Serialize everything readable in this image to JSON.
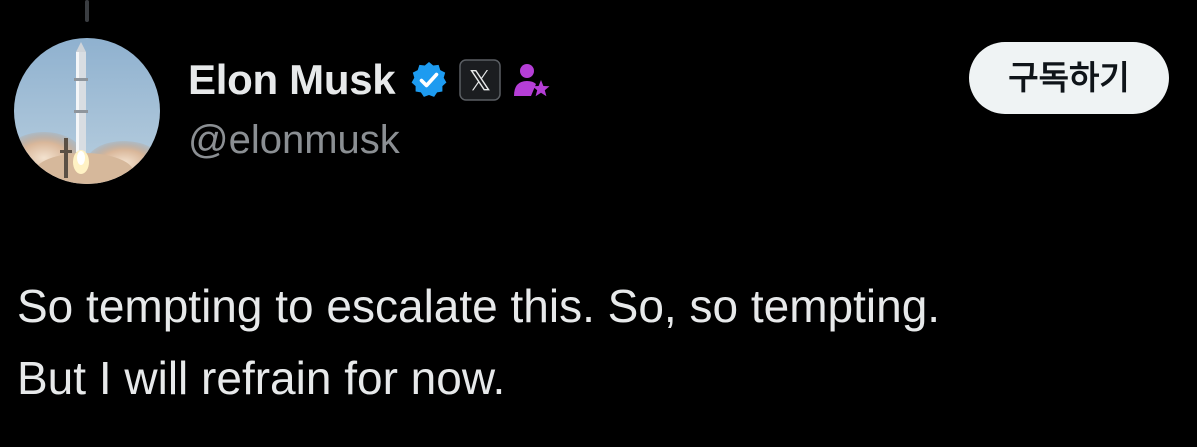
{
  "tweet": {
    "author": {
      "display_name": "Elon Musk",
      "handle": "@elonmusk",
      "avatar_icon": "rocket-launch-photo",
      "badges": [
        "verified-badge-icon",
        "x-affiliate-badge-icon",
        "subscriber-badge-icon"
      ],
      "affiliate_badge_text": "𝕏"
    },
    "subscribe_label": "구독하기",
    "text_lines": [
      "So tempting to escalate this. So, so tempting.",
      "But I will refrain for now."
    ]
  },
  "colors": {
    "background": "#000000",
    "primary_text": "#e7e9ea",
    "secondary_text": "#8b8f93",
    "verified_blue": "#1d9bf0",
    "subscriber_purple": "#b53ed6",
    "button_bg": "#eff3f4"
  }
}
